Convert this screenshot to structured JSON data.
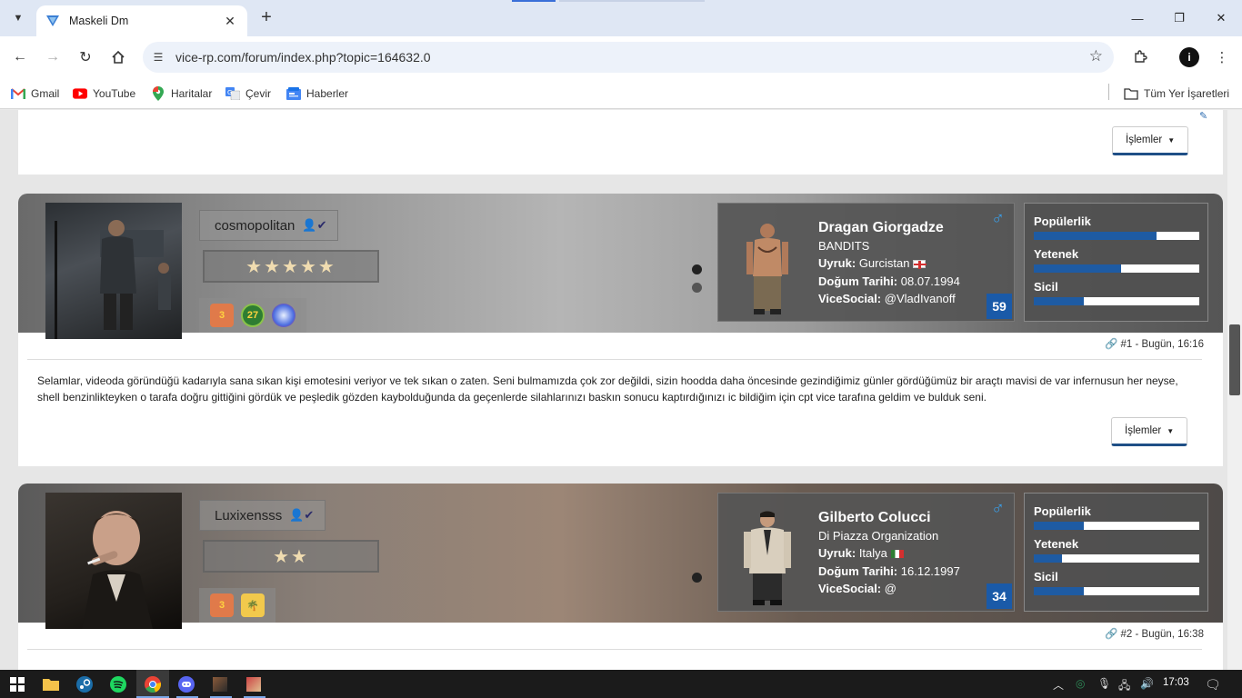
{
  "browser": {
    "tab_title": "Maskeli Dm",
    "tab_close": "✕",
    "new_tab": "+",
    "url": "vice-rp.com/forum/index.php?topic=164632.0",
    "bookmarks": [
      {
        "label": "Gmail",
        "icon": "gmail-icon"
      },
      {
        "label": "YouTube",
        "icon": "youtube-icon"
      },
      {
        "label": "Haritalar",
        "icon": "maps-icon"
      },
      {
        "label": "Çevir",
        "icon": "translate-icon"
      },
      {
        "label": "Haberler",
        "icon": "news-icon"
      }
    ],
    "all_bookmarks": "Tüm Yer İşaretleri",
    "profile_initial": "i"
  },
  "actions_label": "İşlemler",
  "posts": [
    {
      "username": "cosmopolitan",
      "stars": "★★★★★",
      "badge_level": "3",
      "badge_num": "27",
      "character": {
        "name": "Dragan Giorgadze",
        "org": "BANDITS",
        "nationality_label": "Uyruk:",
        "nationality": "Gurcistan",
        "birth_label": "Doğum Tarihi:",
        "birth": "08.07.1994",
        "social_label": "ViceSocial:",
        "social": "@VladIvanoff",
        "level": "59",
        "gender_icon": "♂"
      },
      "stats": [
        {
          "label": "Popülerlik",
          "value": 0.74
        },
        {
          "label": "Yetenek",
          "value": 0.53
        },
        {
          "label": "Sicil",
          "value": 0.3
        }
      ],
      "meta": "#1 - Bugün, 16:16",
      "text": "Selamlar, videoda göründüğü kadarıyla sana sıkan kişi emotesini veriyor ve tek sıkan o zaten. Seni bulmamızda çok zor değildi, sizin hoodda daha öncesinde gezindiğimiz günler gördüğümüz bir araçtı mavisi de var infernusun her neyse, shell benzinlikteyken o tarafa doğru gittiğini gördük ve peşledik gözden kaybolduğunda da geçenlerde silahlarınızı baskın sonucu kaptırdığınızı ic bildiğim için cpt vice tarafına geldim ve bulduk seni."
    },
    {
      "username": "Luxixensss",
      "stars": "★★",
      "badge_level": "3",
      "character": {
        "name": "Gilberto Colucci",
        "org": "Di Piazza Organization",
        "nationality_label": "Uyruk:",
        "nationality": "Italya",
        "birth_label": "Doğum Tarihi:",
        "birth": "16.12.1997",
        "social_label": "ViceSocial:",
        "social": "@",
        "level": "34",
        "gender_icon": "♂"
      },
      "stats": [
        {
          "label": "Popülerlik",
          "value": 0.3
        },
        {
          "label": "Yetenek",
          "value": 0.17
        },
        {
          "label": "Sicil",
          "value": 0.3
        }
      ],
      "meta": "#2 - Bugün, 16:38"
    }
  ],
  "taskbar": {
    "clock": "17:03"
  },
  "colors": {
    "accent": "#1e5ba3",
    "gender": "#3a9ee8"
  }
}
